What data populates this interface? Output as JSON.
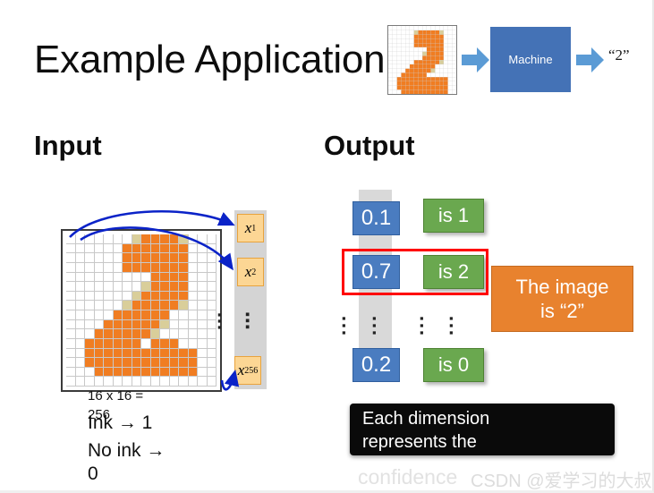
{
  "slide": {
    "title": "Example Application"
  },
  "header_flow": {
    "image_alt": "handwritten-digit-2-grid",
    "machine_label": "Machine",
    "output_label": "“2”",
    "arrow_icon": "right-arrow-icon",
    "colors": {
      "machine_box": "#4472b6",
      "arrow": "#5b9bd5",
      "ink": "#f07d22"
    }
  },
  "input": {
    "heading": "Input",
    "vector_labels": [
      "x",
      "x",
      "x"
    ],
    "vector_subscripts": [
      "1",
      "2",
      "256"
    ],
    "vertical_ellipsis": "⋮",
    "captions": {
      "size": "16 x 16 =",
      "size_value": "256",
      "ink": "Ink → 1",
      "no_ink": "No ink →",
      "no_ink_value": "0"
    },
    "grid": {
      "rows": 16,
      "cols": 16,
      "legend": {
        "0": "white / no ink",
        "1": "orange ink",
        "2": "pale ink"
      },
      "cells": [
        [
          0,
          0,
          0,
          0,
          0,
          0,
          0,
          2,
          1,
          1,
          1,
          1,
          2,
          0,
          0,
          0
        ],
        [
          0,
          0,
          0,
          0,
          0,
          0,
          1,
          1,
          1,
          1,
          1,
          1,
          1,
          0,
          0,
          0
        ],
        [
          0,
          0,
          0,
          0,
          0,
          0,
          1,
          1,
          1,
          1,
          1,
          1,
          1,
          0,
          0,
          0
        ],
        [
          0,
          0,
          0,
          0,
          0,
          0,
          1,
          1,
          1,
          1,
          1,
          1,
          1,
          0,
          0,
          0
        ],
        [
          0,
          0,
          0,
          0,
          0,
          0,
          0,
          0,
          0,
          1,
          1,
          1,
          1,
          0,
          0,
          0
        ],
        [
          0,
          0,
          0,
          0,
          0,
          0,
          0,
          0,
          2,
          1,
          1,
          1,
          1,
          0,
          0,
          0
        ],
        [
          0,
          0,
          0,
          0,
          0,
          0,
          0,
          2,
          1,
          1,
          1,
          1,
          1,
          0,
          0,
          0
        ],
        [
          0,
          0,
          0,
          0,
          0,
          0,
          2,
          1,
          1,
          1,
          1,
          1,
          2,
          0,
          0,
          0
        ],
        [
          0,
          0,
          0,
          0,
          0,
          1,
          1,
          1,
          1,
          1,
          1,
          0,
          0,
          0,
          0,
          0
        ],
        [
          0,
          0,
          0,
          0,
          1,
          1,
          1,
          1,
          1,
          1,
          2,
          0,
          0,
          0,
          0,
          0
        ],
        [
          0,
          0,
          0,
          1,
          1,
          1,
          1,
          1,
          1,
          2,
          0,
          0,
          0,
          0,
          0,
          0
        ],
        [
          0,
          0,
          1,
          1,
          1,
          1,
          1,
          1,
          0,
          1,
          1,
          1,
          0,
          0,
          0,
          0
        ],
        [
          0,
          0,
          1,
          1,
          1,
          1,
          1,
          1,
          1,
          1,
          1,
          1,
          1,
          1,
          0,
          0
        ],
        [
          0,
          0,
          1,
          1,
          1,
          1,
          1,
          1,
          1,
          1,
          1,
          1,
          1,
          1,
          0,
          0
        ],
        [
          0,
          0,
          0,
          1,
          1,
          1,
          1,
          1,
          1,
          1,
          1,
          1,
          1,
          1,
          0,
          0
        ],
        [
          0,
          0,
          0,
          0,
          0,
          0,
          0,
          0,
          0,
          0,
          0,
          0,
          0,
          0,
          0,
          0
        ]
      ]
    }
  },
  "output": {
    "heading": "Output",
    "rows": [
      {
        "value": "0.1",
        "label": "is 1",
        "highlighted": false
      },
      {
        "value": "0.7",
        "label": "is 2",
        "highlighted": true
      },
      {
        "value": "0.2",
        "label": "is 0",
        "highlighted": false
      }
    ],
    "vertical_ellipsis": "⋮",
    "highlight_color": "#ff0000",
    "value_box_color": "#4a7cc0",
    "label_box_color": "#6aa84f",
    "callout": {
      "line1": "The image",
      "line2": "is  “2”",
      "color": "#e8822e"
    },
    "tooltip": {
      "line1": "Each dimension",
      "line2": "represents the",
      "line3": "confidence"
    }
  },
  "watermark": {
    "text": "CSDN @爱学习的大叔"
  }
}
